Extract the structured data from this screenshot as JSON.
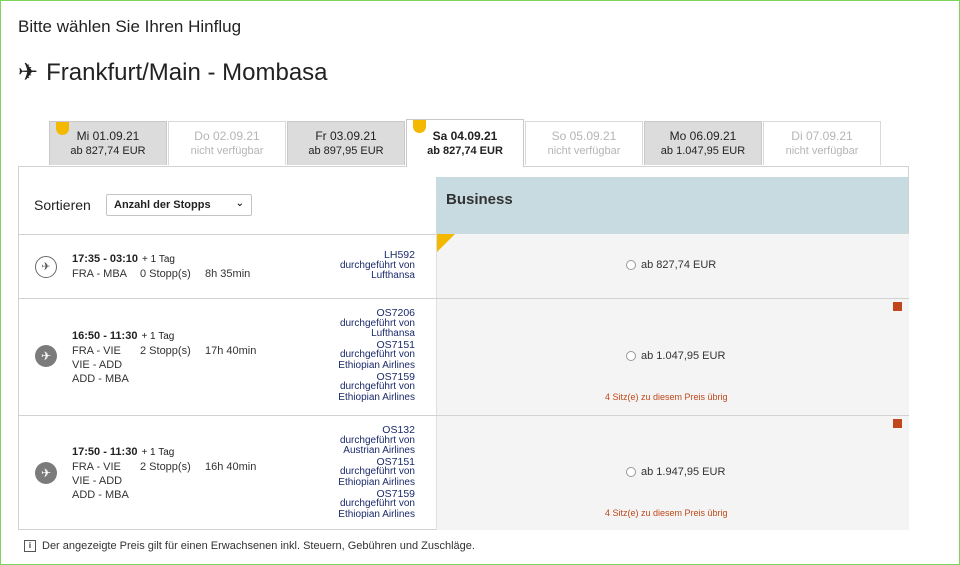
{
  "heading": "Bitte wählen Sie Ihren Hinflug",
  "route": "Frankfurt/Main - Mombasa",
  "dates": [
    {
      "day": "Mi 01.09.21",
      "price": "ab 827,74 EUR",
      "status": "avail",
      "badge": true
    },
    {
      "day": "Do 02.09.21",
      "price": "nicht verfügbar",
      "status": "na",
      "badge": false
    },
    {
      "day": "Fr 03.09.21",
      "price": "ab 897,95 EUR",
      "status": "avail",
      "badge": false
    },
    {
      "day": "Sa 04.09.21",
      "price": "ab 827,74 EUR",
      "status": "selected",
      "badge": true
    },
    {
      "day": "So 05.09.21",
      "price": "nicht verfügbar",
      "status": "na",
      "badge": false
    },
    {
      "day": "Mo 06.09.21",
      "price": "ab 1.047,95 EUR",
      "status": "avail",
      "badge": false
    },
    {
      "day": "Di 07.09.21",
      "price": "nicht verfügbar",
      "status": "na",
      "badge": false
    }
  ],
  "sort": {
    "label": "Sortieren",
    "selected": "Anzahl der Stopps"
  },
  "cabin": "Business",
  "flights": [
    {
      "icon": "lufthansa-icon",
      "times": "17:35 - 03:10",
      "plus": "+ 1 Tag",
      "legs": [
        "FRA - MBA"
      ],
      "stops": "0 Stopp(s)",
      "duration": "8h 35min",
      "carrier": [
        {
          "flight": "LH592",
          "operated": "durchgeführt von",
          "airline": "Lufthansa"
        }
      ],
      "fare": "ab 827,74 EUR",
      "seats": ""
    },
    {
      "icon": "airplane-icon",
      "times": "16:50 - 11:30",
      "plus": "+ 1 Tag",
      "legs": [
        "FRA - VIE",
        "VIE - ADD",
        "ADD - MBA"
      ],
      "stops": "2 Stopp(s)",
      "duration": "17h 40min",
      "carrier": [
        {
          "flight": "OS7206",
          "operated": "durchgeführt von",
          "airline": "Lufthansa"
        },
        {
          "flight": "OS7151",
          "operated": "durchgeführt von",
          "airline": "Ethiopian Airlines"
        },
        {
          "flight": "OS7159",
          "operated": "durchgeführt von",
          "airline": "Ethiopian Airlines"
        }
      ],
      "fare": "ab 1.047,95 EUR",
      "seats": "4 Sitz(e) zu diesem Preis übrig"
    },
    {
      "icon": "airplane-icon",
      "times": "17:50 - 11:30",
      "plus": "+ 1 Tag",
      "legs": [
        "FRA - VIE",
        "VIE - ADD",
        "ADD - MBA"
      ],
      "stops": "2 Stopp(s)",
      "duration": "16h 40min",
      "carrier": [
        {
          "flight": "OS132",
          "operated": "durchgeführt von",
          "airline": "Austrian Airlines"
        },
        {
          "flight": "OS7151",
          "operated": "durchgeführt von",
          "airline": "Ethiopian Airlines"
        },
        {
          "flight": "OS7159",
          "operated": "durchgeführt von",
          "airline": "Ethiopian Airlines"
        }
      ],
      "fare": "ab 1.947,95 EUR",
      "seats": "4 Sitz(e) zu diesem Preis übrig"
    }
  ],
  "note": "Der angezeigte Preis gilt für einen Erwachsenen inkl. Steuern, Gebühren und Zuschläge.",
  "colors": {
    "accent": "#f5b800",
    "cabin_header": "#c8dbe1",
    "seats_text": "#c0481b",
    "frame": "#7dd45a"
  }
}
